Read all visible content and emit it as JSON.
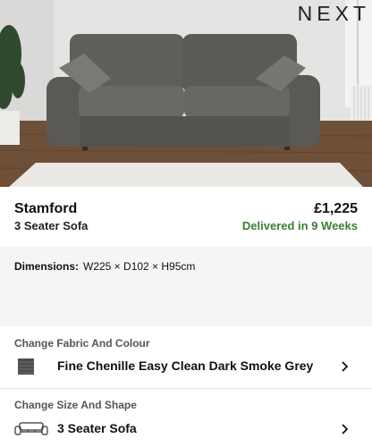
{
  "brand": {
    "logo_text": "NEXT"
  },
  "product": {
    "name": "Stamford",
    "subtitle": "3 Seater Sofa",
    "price": "£1,225",
    "delivery": "Delivered in 9 Weeks"
  },
  "dimensions": {
    "label": "Dimensions:",
    "value": "W225 × D102 × H95cm"
  },
  "options": {
    "fabric": {
      "title": "Change Fabric And Colour",
      "value": "Fine Chenille Easy Clean Dark Smoke Grey",
      "icon": "fabric-swatch-icon"
    },
    "size": {
      "title": "Change Size And Shape",
      "value": "3 Seater Sofa",
      "icon": "sofa-outline-icon"
    }
  },
  "colors": {
    "delivery_green": "#3e7c37",
    "sofa_grey": "#5f5e5b"
  }
}
